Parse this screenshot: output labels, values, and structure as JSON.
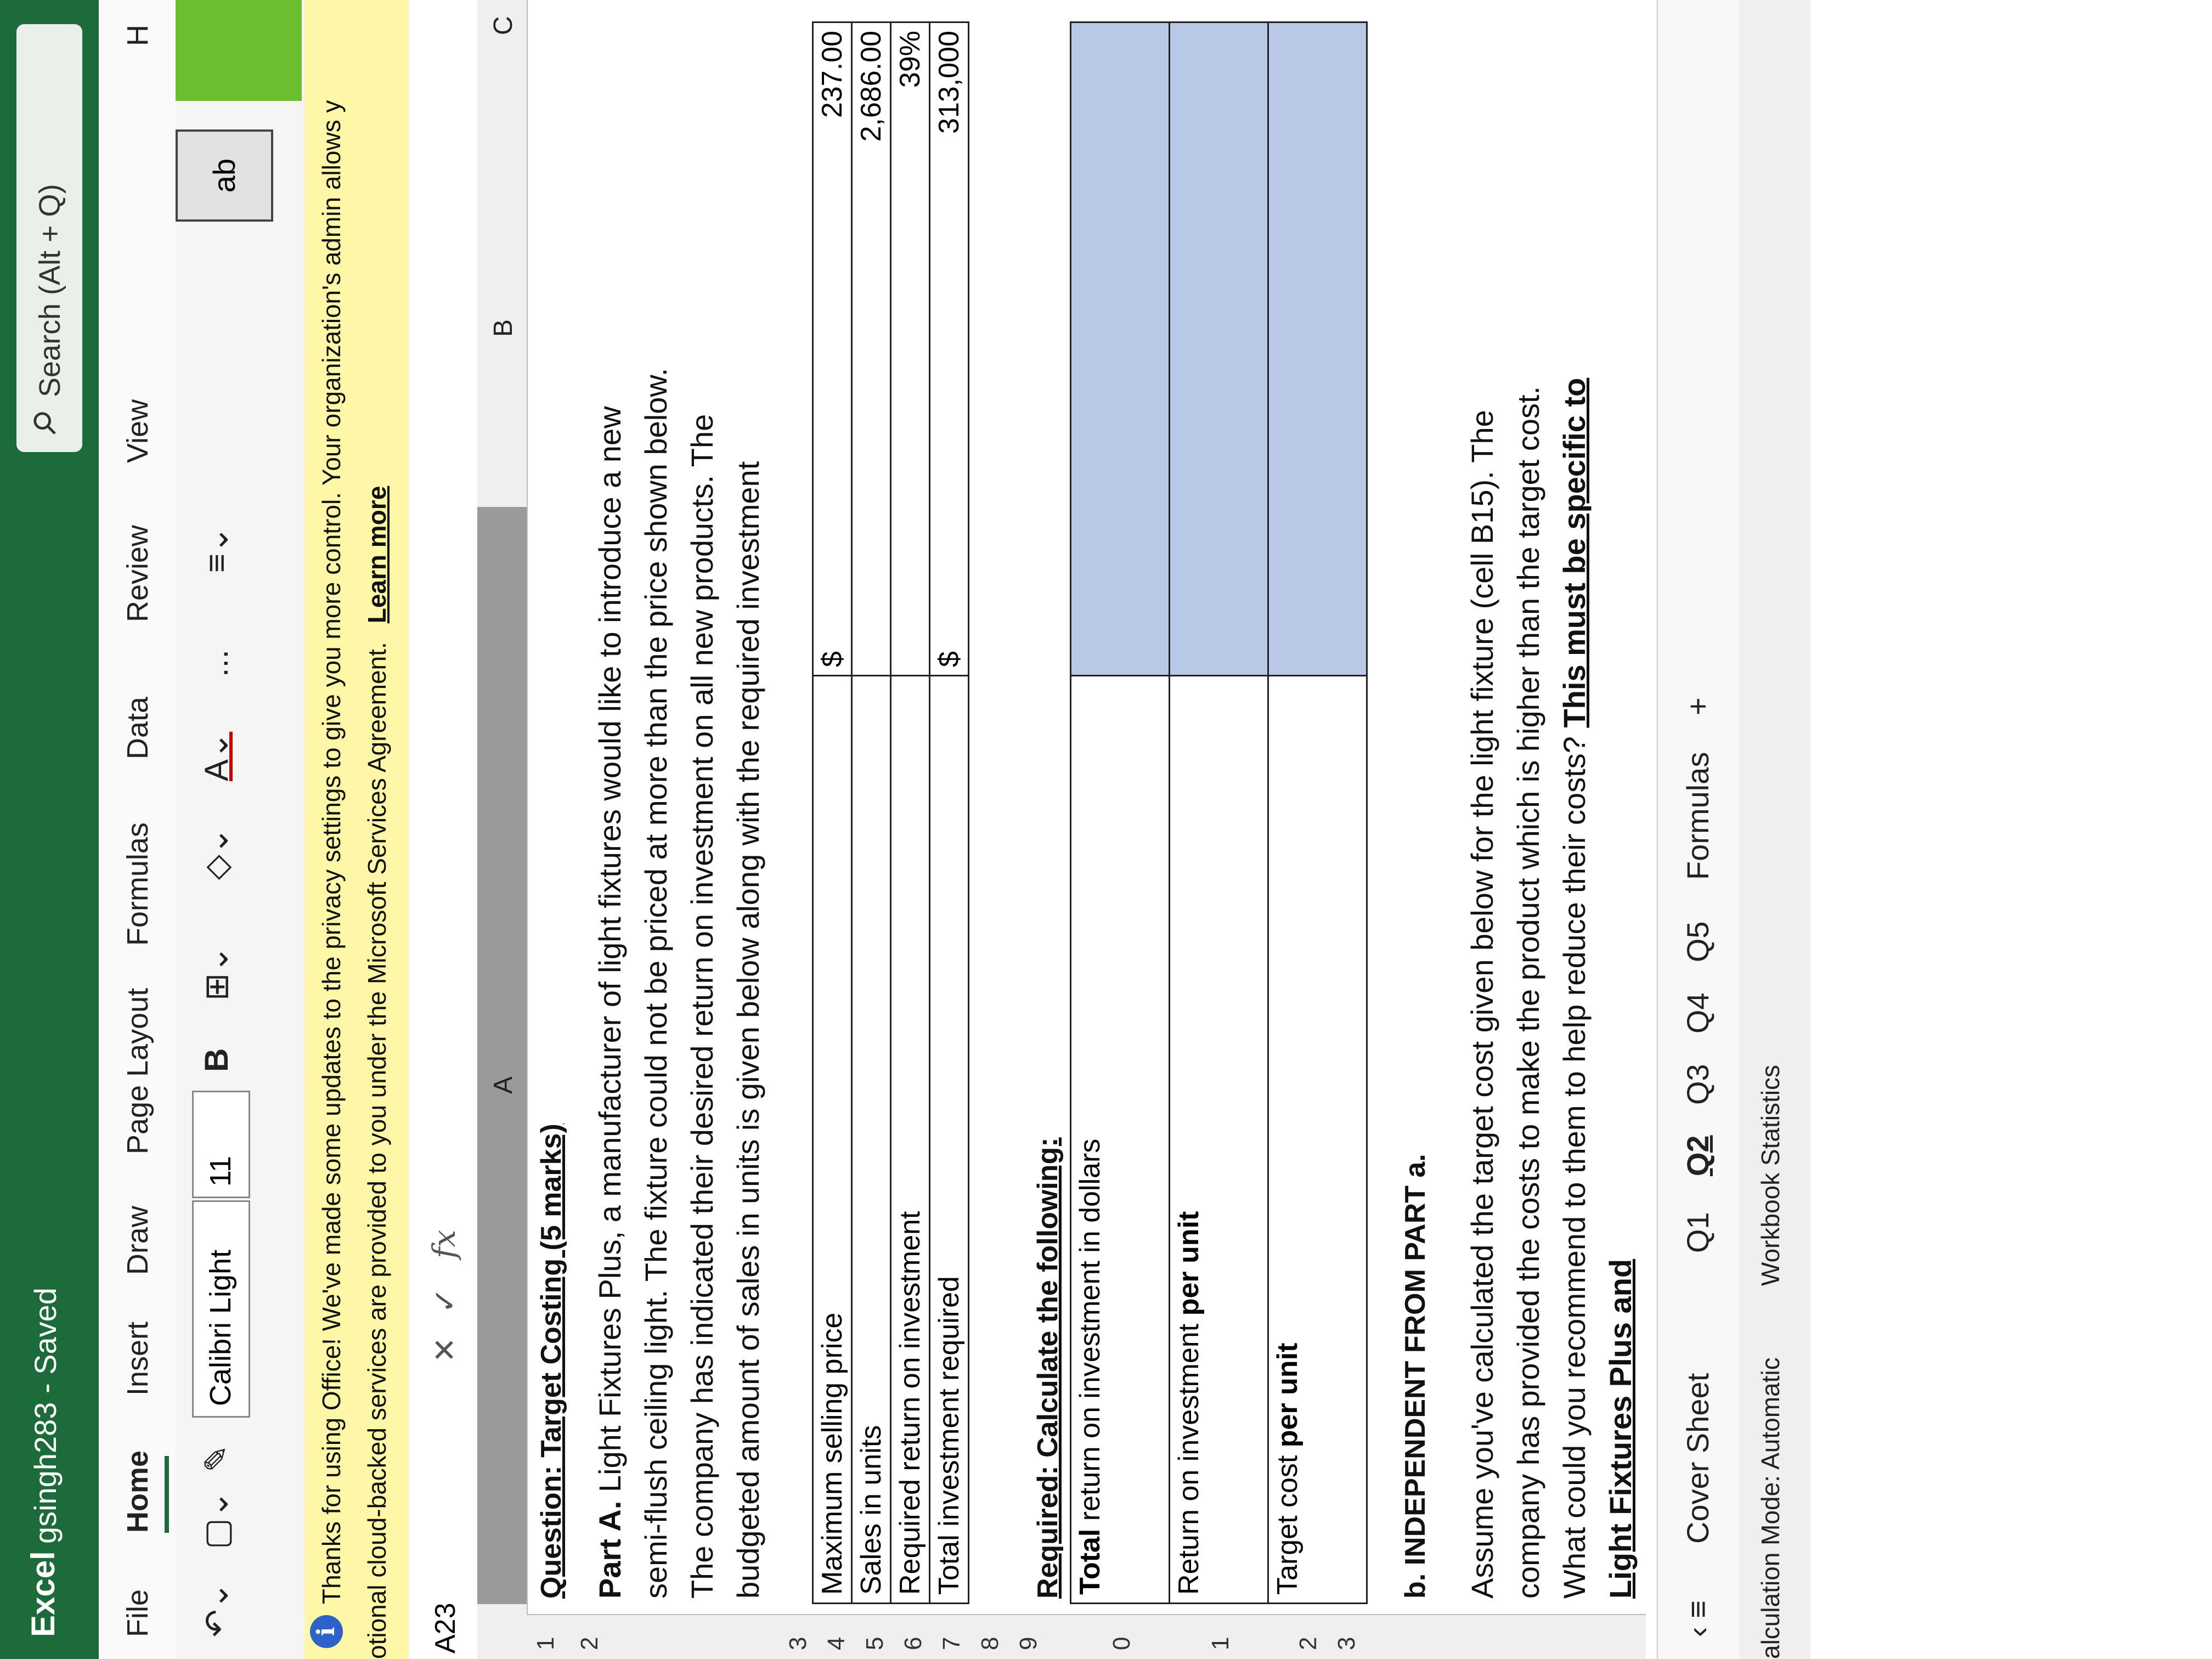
{
  "app": {
    "name": "Excel",
    "doc_title": "gsingh283 - Saved",
    "search_placeholder": "Search (Alt + Q)"
  },
  "menu": [
    "File",
    "Home",
    "Insert",
    "Draw",
    "Page Layout",
    "Formulas",
    "Data",
    "Review",
    "View",
    "H"
  ],
  "ribbon": {
    "font_name": "Calibri Light",
    "font_size": "11",
    "bold_label": "B",
    "more": "...",
    "wrap_label": "ab"
  },
  "notice": {
    "line1": "Thanks for using Office! We've made some updates to the privacy settings to give you more control. Your organization's admin allows y",
    "line2": "otional cloud-backed services are provided to you under the Microsoft Services Agreement.",
    "link": "Learn more"
  },
  "formula_bar": {
    "cell_ref": "A23",
    "cancel": "✕",
    "enter": "✓",
    "fx": "fx"
  },
  "columns": [
    "A",
    "B",
    "C"
  ],
  "rows": [
    "1",
    "2",
    "3",
    "4",
    "5",
    "6",
    "7",
    "8",
    "9",
    "0",
    "1",
    "2",
    "3"
  ],
  "sheet": {
    "question": "Question: Target Costing (5 marks)",
    "part_a_label": "Part A.",
    "part_a_text": "Light Fixtures Plus, a manufacturer of light fixtures would like to introduce a new semi-flush ceiling light.  The fixture could not be priced at more than the price shown below.  The company has indicated their desired return on investment on all new products.  The budgeted amount of sales in units is given below along with the required investment",
    "inputs": [
      {
        "label": "Maximum selling price",
        "symbol": "$",
        "value": "237.00"
      },
      {
        "label": "Sales in units",
        "symbol": "",
        "value": "2,686.00"
      },
      {
        "label": "Required return on investment",
        "symbol": "",
        "value": "39%"
      },
      {
        "label": "Total investment required",
        "symbol": "$",
        "value": "313,000"
      }
    ],
    "required_label": "Required: Calculate the following:",
    "calc_rows": [
      {
        "bold": "Total",
        "rest": " return on investment in dollars"
      },
      {
        "bold": "",
        "rest": "Return on investment ",
        "bold_tail": "per unit"
      },
      {
        "bold": "",
        "rest": "Target cost ",
        "bold_tail": "per unit"
      }
    ],
    "part_b_label": "b. INDEPENDENT FROM PART a.",
    "part_b_text": "Assume you've calculated the target cost given below for the light fixture (cell B15).  The company has provided the costs to make the product which is higher than the target cost.  What could you recommend to them to help reduce their costs? ",
    "part_b_bold": "This must be specific to Light Fixtures Plus and"
  },
  "sheet_tabs": [
    "Cover Sheet",
    "Q1",
    "Q2",
    "Q3",
    "Q4",
    "Q5",
    "Formulas",
    "+"
  ],
  "active_tab": "Q2",
  "status": {
    "calc_mode": "alculation Mode: Automatic",
    "stats": "Workbook Statistics"
  }
}
